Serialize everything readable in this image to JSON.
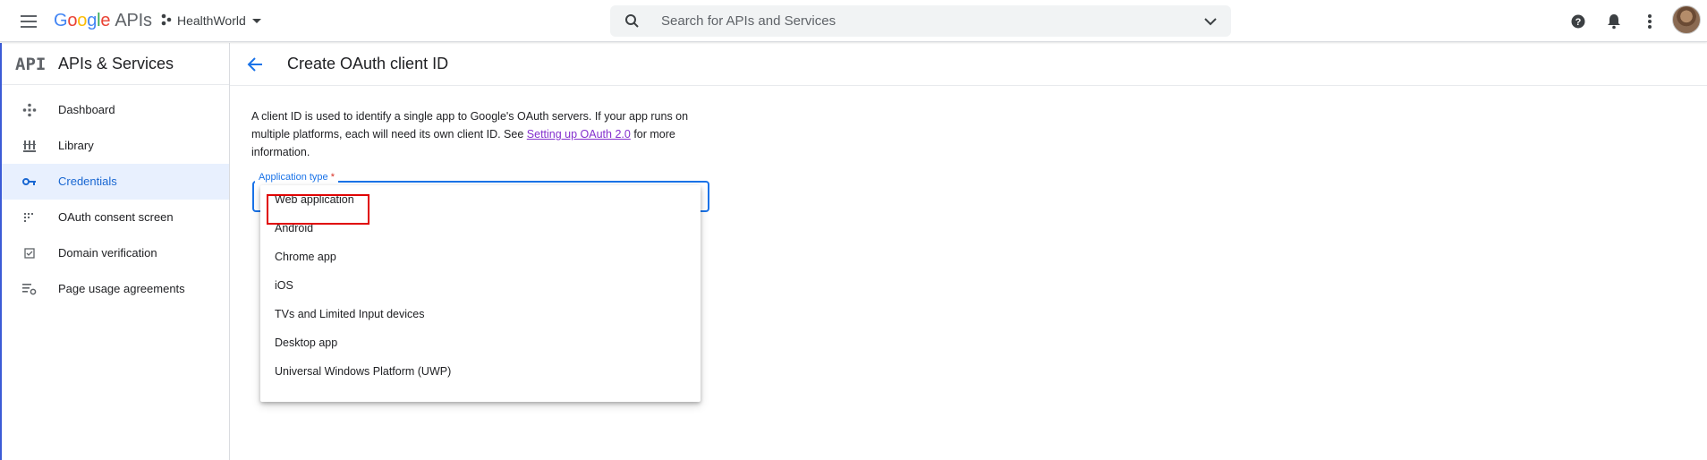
{
  "topbar": {
    "logo_google": "Google",
    "logo_apis": "APIs",
    "project_name": "HealthWorld",
    "search_placeholder": "Search for APIs and Services"
  },
  "icons": {
    "menu": "menu-icon",
    "project": "project-icon",
    "search": "search-icon",
    "help": "help-icon",
    "notifications": "bell-icon",
    "more": "more-vert-icon",
    "back": "arrow-back-icon"
  },
  "sidebar": {
    "mark": "API",
    "title": "APIs & Services",
    "items": [
      {
        "label": "Dashboard",
        "icon": "dashboard-icon"
      },
      {
        "label": "Library",
        "icon": "library-icon"
      },
      {
        "label": "Credentials",
        "icon": "key-icon",
        "active": true
      },
      {
        "label": "OAuth consent screen",
        "icon": "consent-icon"
      },
      {
        "label": "Domain verification",
        "icon": "checkbox-icon"
      },
      {
        "label": "Page usage agreements",
        "icon": "settings-list-icon"
      }
    ]
  },
  "main": {
    "title": "Create OAuth client ID",
    "intro_before": "A client ID is used to identify a single app to Google's OAuth servers. If your app runs on multiple platforms, each will need its own client ID. See ",
    "intro_link": "Setting up OAuth 2.0",
    "intro_after": " for more information.",
    "field_label": "Application type",
    "field_required": "*",
    "options": [
      "Web application",
      "Android",
      "Chrome app",
      "iOS",
      "TVs and Limited Input devices",
      "Desktop app",
      "Universal Windows Platform (UWP)"
    ]
  },
  "colors": {
    "accent": "#1a73e8",
    "active_bg": "#e8f0fe",
    "link": "#8430ce",
    "highlight": "#e00000"
  }
}
